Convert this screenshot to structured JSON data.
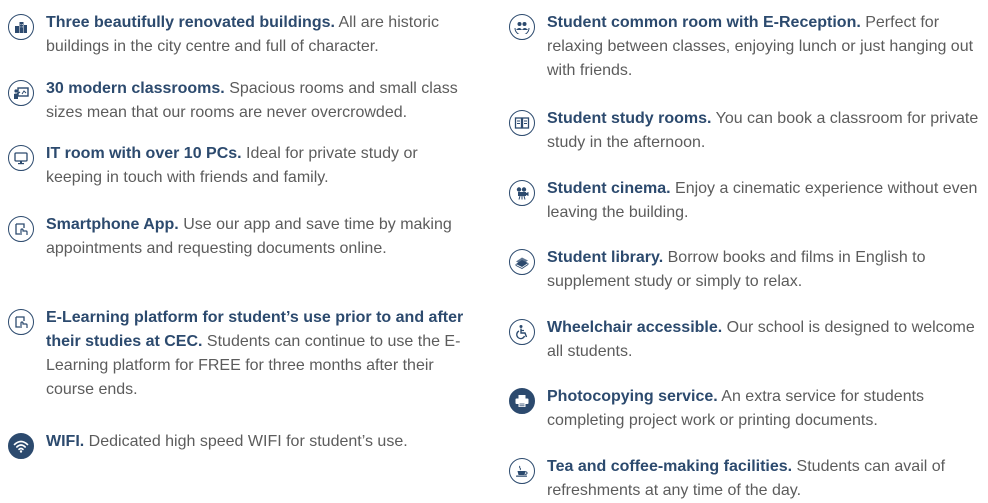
{
  "left_column": [
    {
      "icon": "buildings-icon",
      "title": "Three beautifully renovated buildings.",
      "body": " All  are historic buildings in the city centre and full of character."
    },
    {
      "icon": "classroom-board-icon",
      "title": "30 modern classrooms.",
      "body": " Spacious rooms and small class sizes mean that our rooms are never overcrowded."
    },
    {
      "icon": "monitor-icon",
      "title": "IT room with over 10 PCs.",
      "body": " Ideal for private study or keeping in touch with friends and family."
    },
    {
      "icon": "smartphone-touch-icon",
      "title": "Smartphone App.",
      "body": " Use our app and save time by making appointments and requesting documents online."
    },
    {
      "icon": "touch-learning-icon",
      "title": "E-Learning platform for student’s use prior to and after their studies at CEC.",
      "body": " Students can continue to use the E-Learning platform for FREE for three months after their course ends."
    },
    {
      "icon": "wifi-icon",
      "title": "WIFI.",
      "body": " Dedicated high speed WIFI for student’s use."
    }
  ],
  "right_column": [
    {
      "icon": "reception-people-icon",
      "title": "Student common room with E-Reception.",
      "body": " Perfect for relaxing between classes, enjoying lunch or just hanging out with friends."
    },
    {
      "icon": "open-book-icon",
      "title": "Student study rooms.",
      "body": " You can book a classroom for private study in the afternoon."
    },
    {
      "icon": "film-camera-icon",
      "title": "Student cinema.",
      "body": " Enjoy a cinematic experience without even leaving the building."
    },
    {
      "icon": "books-icon",
      "title": "Student library.",
      "body": " Borrow books and films in English to supplement study or simply to relax."
    },
    {
      "icon": "wheelchair-icon",
      "title": "Wheelchair accessible.",
      "body": " Our school is designed to welcome all students."
    },
    {
      "icon": "printer-icon",
      "title": "Photocopying service.",
      "body": " An extra service for students completing project work or printing documents."
    },
    {
      "icon": "coffee-cup-icon",
      "title": "Tea and coffee-making facilities.",
      "body": " Students can avail of refreshments at any time of the day."
    }
  ],
  "colors": {
    "heading": "#2c4a6e",
    "body_text": "#5c5c5c",
    "icon_stroke": "#2c4a6e"
  }
}
